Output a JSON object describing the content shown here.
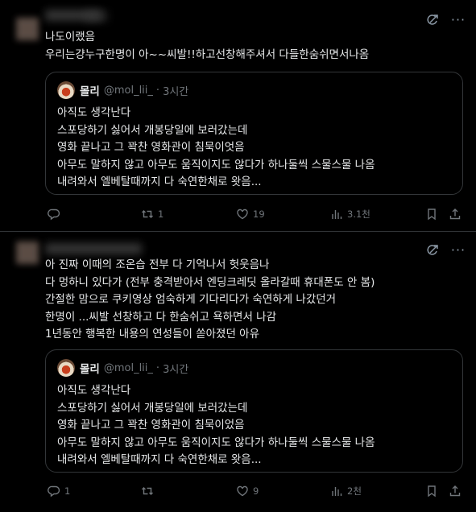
{
  "post1": {
    "lines": [
      "나도이랬음",
      "우리는걍누구한명이 아~~씨발!!하고선창해주셔서 다들한숨쉬면서나옴"
    ],
    "quote": {
      "name": "몰리",
      "handle": "@mol_lii_",
      "dot": "·",
      "time": "3시간",
      "lines": [
        "아직도 생각난다",
        "스포당하기 싫어서 개봉당일에 보러갔는데",
        "영화 끝나고 그 꽉찬 영화관이 침묵이엇음",
        "아무도 말하지 않고 아무도 움직이지도 않다가 하나둘씩 스물스물 나옴",
        "내려와서 엘베탈때까지 다 숙연한채로 왓음..."
      ]
    },
    "actions": {
      "reply": "",
      "repost": "1",
      "like": "19",
      "views": "3.1천"
    }
  },
  "post2": {
    "lines": [
      "아 진짜 이때의 조온습 전부 다 기억나서 헛웃음나",
      "다 멍하니 있다가 (전부 충격받아서 엔딩크레딧 올라갈때 휴대폰도 안 봄)",
      "간절한 맘으로 쿠키영상 엄숙하게 기다리다가 숙연하게 나갔던거",
      "한명이 ...씨발 선창하고 다 한숨쉬고 욕하면서 나감",
      "1년동안 행복한 내용의 연성들이 쏟아졌던 아유"
    ],
    "quote": {
      "name": "몰리",
      "handle": "@mol_lii_",
      "dot": "·",
      "time": "3시간",
      "lines": [
        "아직도 생각난다",
        "스포당하기 싫어서 개봉당일에 보러갔는데",
        "영화 끝나고 그 꽉찬 영화관이 침묵이었음",
        "아무도 말하지 않고 아무도 움직이지도 않다가 하나둘씩 스물스물 나옴",
        "내려와서 엘베탈때까지 다 숙연한채로 왓음..."
      ]
    },
    "actions": {
      "reply": "1",
      "repost": "",
      "like": "9",
      "views": "2천"
    }
  },
  "icons": {
    "grok": "grok-icon",
    "more": "more-icon",
    "reply": "reply-icon",
    "repost": "repost-icon",
    "like": "heart-icon",
    "views": "views-icon",
    "bookmark": "bookmark-icon",
    "share": "share-icon"
  },
  "colors": {
    "background": "#000000",
    "text": "#e7e9ea",
    "muted": "#71767b",
    "border": "#2f3336"
  }
}
